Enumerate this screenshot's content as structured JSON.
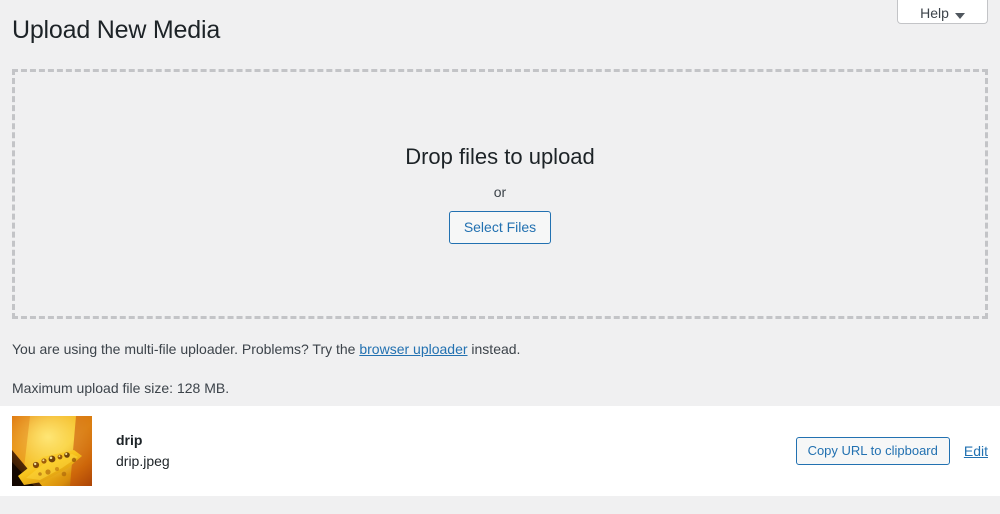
{
  "header": {
    "page_title": "Upload New Media",
    "help_tab": {
      "label": "Help",
      "caret_icon": "chevron-down-icon"
    }
  },
  "uploader": {
    "drop_headline": "Drop files to upload",
    "or_label": "or",
    "select_files_label": "Select Files",
    "multifile_notice_prefix": "You are using the multi-file uploader. Problems? Try the ",
    "browser_uploader_link": "browser uploader",
    "multifile_notice_suffix": " instead.",
    "max_upload_notice": "Maximum upload file size: 128 MB."
  },
  "media_items": [
    {
      "thumbnail_alt": "flower-petal-with-water-droplets-thumbnail",
      "title": "drip",
      "filename": "drip.jpeg",
      "copy_url_label": "Copy URL to clipboard",
      "edit_label": "Edit"
    }
  ],
  "colors": {
    "page_background": "#f0f0f1",
    "accent_blue": "#2271b1",
    "text_dark": "#1d2327",
    "text_body": "#3c434a",
    "border_gray": "#c3c4c7",
    "row_background": "#ffffff"
  }
}
